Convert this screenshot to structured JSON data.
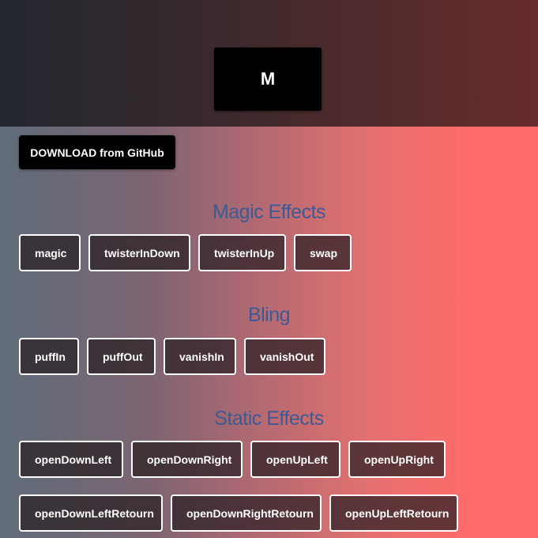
{
  "header": {
    "logo_text": "M"
  },
  "download_label": "DOWNLOAD from GitHub",
  "sections": [
    {
      "title": "Magic Effects",
      "rows": [
        [
          "magic",
          "twisterInDown",
          "twisterInUp",
          "swap"
        ]
      ]
    },
    {
      "title": "Bling",
      "rows": [
        [
          "puffIn",
          "puffOut",
          "vanishIn",
          "vanishOut"
        ]
      ]
    },
    {
      "title": "Static Effects",
      "rows": [
        [
          "openDownLeft",
          "openDownRight",
          "openUpLeft",
          "openUpRight"
        ],
        [
          "openDownLeftRetourn",
          "openDownRightRetourn",
          "openUpLeftRetourn"
        ]
      ]
    }
  ],
  "colors": {
    "title": "#3e5a93",
    "button_border": "#ffffff",
    "logo_bg": "#000000"
  }
}
